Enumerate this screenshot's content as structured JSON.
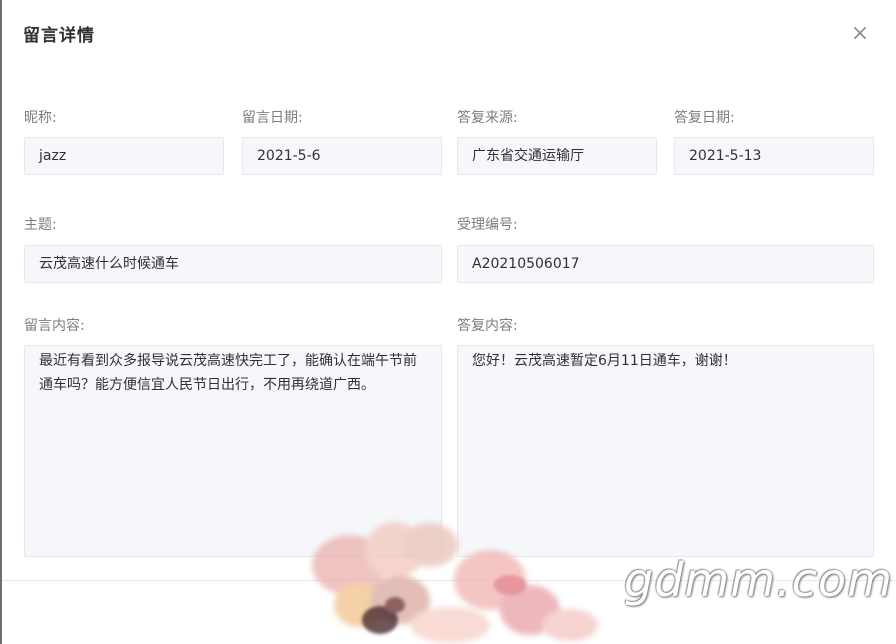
{
  "dialog": {
    "title": "留言详情",
    "close_glyph": "×"
  },
  "fields": {
    "nickname_label": "昵称:",
    "nickname_value": "jazz",
    "message_date_label": "留言日期:",
    "message_date_value": "2021-5-6",
    "reply_source_label": "答复来源:",
    "reply_source_value": "广东省交通运输厅",
    "reply_date_label": "答复日期:",
    "reply_date_value": "2021-5-13",
    "subject_label": "主题:",
    "subject_value": "云茂高速什么时候通车",
    "ticket_number_label": "受理编号:",
    "ticket_number_value": "A20210506017",
    "message_content_label": "留言内容:",
    "message_content_value": "最近有看到众多报导说云茂高速快完工了，能确认在端午节前通车吗？能方便信宜人民节日出行，不用再绕道广西。",
    "reply_content_label": "答复内容:",
    "reply_content_value": "您好！云茂高速暂定6月11日通车，谢谢！"
  },
  "watermark": {
    "text": "gdmm.com"
  },
  "colors": {
    "field_background": "#f5f7fa",
    "field_border": "#e4e7ed",
    "label_text": "#7a7d82",
    "value_text": "#303133"
  }
}
